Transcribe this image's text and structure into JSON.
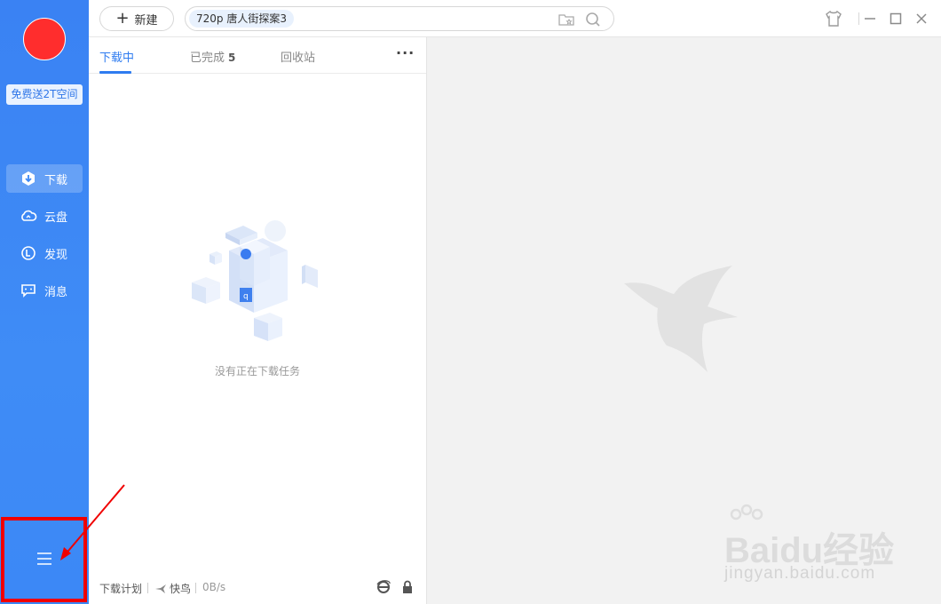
{
  "sidebar": {
    "promo_label": "免费送2T空间",
    "items": [
      {
        "label": "下载",
        "icon": "download-hex-icon",
        "active": true
      },
      {
        "label": "云盘",
        "icon": "cloud-icon",
        "active": false
      },
      {
        "label": "发现",
        "icon": "discover-icon",
        "active": false
      },
      {
        "label": "消息",
        "icon": "message-icon",
        "active": false
      }
    ],
    "menu_icon": "hamburger-menu-icon",
    "avatar_color": "#ff2d2d",
    "accent": "#3c88f6"
  },
  "topbar": {
    "new_label": "新建",
    "search_chip": "720p  唐人街探案3",
    "icons": [
      "folder-star-icon",
      "search-icon",
      "skin-shirt-icon",
      "minimize-icon",
      "maximize-icon",
      "close-icon"
    ]
  },
  "tabs": [
    {
      "label": "下载中",
      "count": ""
    },
    {
      "label": "已完成",
      "count": "5"
    },
    {
      "label": "回收站",
      "count": ""
    }
  ],
  "more_label": "···",
  "empty_message": "没有正在下载任务",
  "statusbar": {
    "plan_label": "下载计划",
    "kuainiao_label": "快鸟",
    "speed": "0B/s",
    "icons": [
      "ie-icon",
      "lock-icon"
    ]
  },
  "watermark": {
    "brand": "Baidu经验",
    "url": "jingyan.baidu.com"
  },
  "colors": {
    "tab_active": "#2f7cf0",
    "highlight_box": "#f00000",
    "detail_bg": "#f2f2f2"
  }
}
